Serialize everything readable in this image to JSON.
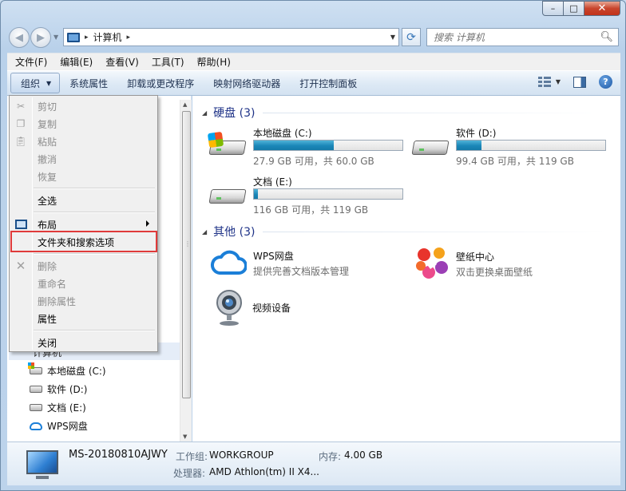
{
  "window": {
    "min": "–",
    "max": "□",
    "close": "✕"
  },
  "nav": {
    "back": "◀",
    "forward": "▶"
  },
  "address": {
    "path": "计算机",
    "crumb_sep": "▸"
  },
  "search": {
    "placeholder": "搜索 计算机"
  },
  "menubar": [
    "文件(F)",
    "编辑(E)",
    "查看(V)",
    "工具(T)",
    "帮助(H)"
  ],
  "commandbar": {
    "organize": "组织",
    "items": [
      "系统属性",
      "卸载或更改程序",
      "映射网络驱动器",
      "打开控制面板"
    ],
    "help": "?"
  },
  "context_menu": {
    "items": [
      {
        "label": "剪切",
        "disabled": true,
        "icon": "scissors-icon"
      },
      {
        "label": "复制",
        "disabled": true,
        "icon": "copy-icon"
      },
      {
        "label": "粘贴",
        "disabled": true,
        "icon": "paste-icon"
      },
      {
        "label": "撤消",
        "disabled": true
      },
      {
        "label": "恢复",
        "disabled": true
      },
      {
        "label": "全选",
        "disabled": false
      },
      {
        "label": "布局",
        "disabled": false,
        "icon": "layout-icon",
        "submenu": true
      },
      {
        "label": "文件夹和搜索选项",
        "disabled": false,
        "highlighted": true
      },
      {
        "label": "删除",
        "disabled": true,
        "icon": "delete-icon"
      },
      {
        "label": "重命名",
        "disabled": true
      },
      {
        "label": "删除属性",
        "disabled": true
      },
      {
        "label": "属性",
        "disabled": false
      },
      {
        "label": "关闭",
        "disabled": false
      }
    ]
  },
  "navpane": {
    "header": "计算机",
    "items": [
      {
        "label": "本地磁盘 (C:)",
        "icon": "system-drive-icon"
      },
      {
        "label": "软件 (D:)",
        "icon": "drive-icon"
      },
      {
        "label": "文档 (E:)",
        "icon": "drive-icon"
      },
      {
        "label": "WPS网盘",
        "icon": "cloud-icon"
      }
    ]
  },
  "groups": {
    "disks": {
      "title": "硬盘 (3)"
    },
    "other": {
      "title": "其他 (3)"
    }
  },
  "drives": [
    {
      "name": "本地磁盘 (C:)",
      "free_text": "27.9 GB 可用，共 60.0 GB",
      "used_fraction": 0.535,
      "system": true
    },
    {
      "name": "软件 (D:)",
      "free_text": "99.4 GB 可用，共 119 GB",
      "used_fraction": 0.165,
      "system": false
    },
    {
      "name": "文档 (E:)",
      "free_text": "116 GB 可用，共 119 GB",
      "used_fraction": 0.025,
      "system": false
    }
  ],
  "other_items": [
    {
      "name": "WPS网盘",
      "desc": "提供完善文档版本管理"
    },
    {
      "name": "壁纸中心",
      "desc": "双击更换桌面壁纸"
    },
    {
      "name": "视频设备",
      "desc": ""
    }
  ],
  "details": {
    "computer_name": "MS-20180810AJWY",
    "workgroup_label": "工作组:",
    "workgroup": "WORKGROUP",
    "memory_label": "内存:",
    "memory": "4.00 GB",
    "cpu_label": "处理器:",
    "cpu": "AMD Athlon(tm) II X4..."
  },
  "colors": {
    "accent": "#1e3287",
    "bar_fill": "#1a86b8",
    "highlight_box": "#e03a3a"
  }
}
